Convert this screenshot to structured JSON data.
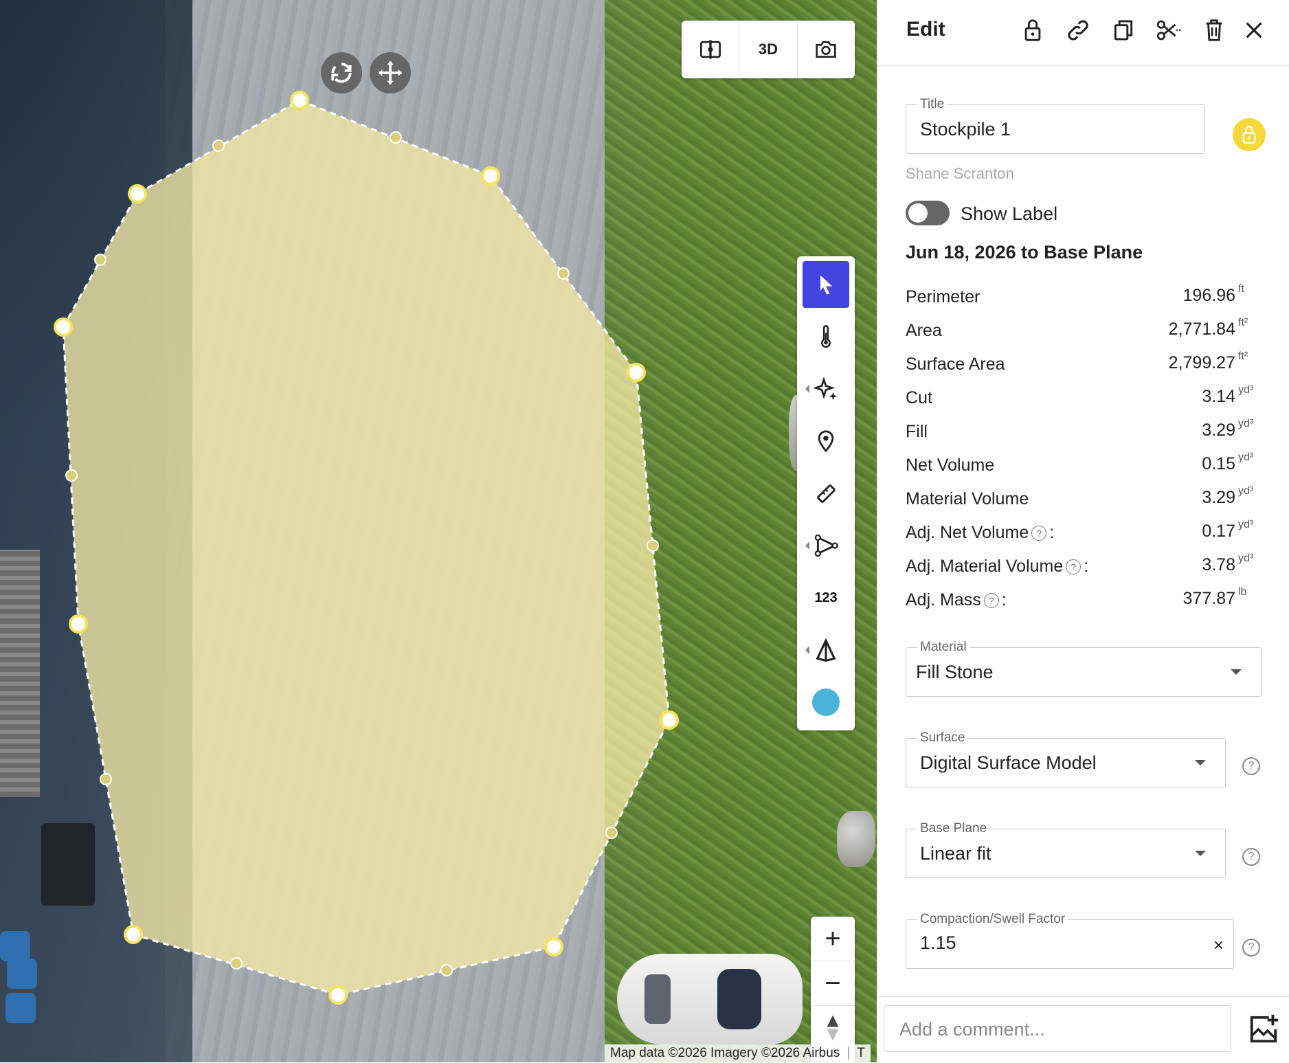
{
  "map": {
    "top_controls": {
      "split_label": "",
      "view3d_label": "3D",
      "camera_label": ""
    },
    "tools": [
      {
        "name": "select",
        "icon": "cursor-arrow-icon",
        "active": true
      },
      {
        "name": "thermal",
        "icon": "thermometer-icon"
      },
      {
        "name": "magic",
        "icon": "sparkle-icon"
      },
      {
        "name": "location",
        "icon": "map-pin-icon"
      },
      {
        "name": "measure",
        "icon": "ruler-icon"
      },
      {
        "name": "path",
        "icon": "path-nodes-icon"
      },
      {
        "name": "count",
        "label": "123"
      },
      {
        "name": "volume",
        "icon": "pyramid-icon"
      },
      {
        "name": "color",
        "icon": "color-dot-icon",
        "color": "#4bb3d8"
      }
    ],
    "zoom": {
      "in": "+",
      "out": "−"
    },
    "attribution": "Map data ©2026 Imagery ©2026 Airbus",
    "attribution_extra": "T",
    "polygon_fill": "#f0e6a0",
    "vertex_color": "#f8e45a"
  },
  "panel": {
    "title": "Edit",
    "header_icons": [
      "lock-open-icon",
      "link-icon",
      "copy-icon",
      "scissors-icon",
      "trash-icon",
      "close-icon"
    ],
    "title_field": {
      "label": "Title",
      "value": "Stockpile 1"
    },
    "author": "Shane Scranton",
    "show_label": {
      "label": "Show Label",
      "on": false
    },
    "comparison": "Jun 18, 2026 to Base Plane",
    "stats": [
      {
        "label": "Perimeter",
        "value": "196.96",
        "unit": "ft"
      },
      {
        "label": "Area",
        "value": "2,771.84",
        "unit": "ft²"
      },
      {
        "label": "Surface Area",
        "value": "2,799.27",
        "unit": "ft²"
      },
      {
        "label": "Cut",
        "value": "3.14",
        "unit": "yd³"
      },
      {
        "label": "Fill",
        "value": "3.29",
        "unit": "yd³"
      },
      {
        "label": "Net Volume",
        "value": "0.15",
        "unit": "yd³"
      },
      {
        "label": "Material Volume",
        "value": "3.29",
        "unit": "yd³"
      },
      {
        "label": "Adj. Net Volume",
        "value": "0.17",
        "unit": "yd³",
        "help": true
      },
      {
        "label": "Adj. Material Volume",
        "value": "3.78",
        "unit": "yd³",
        "help": true
      },
      {
        "label": "Adj. Mass",
        "value": "377.87",
        "unit": "lb",
        "help": true
      }
    ],
    "material": {
      "label": "Material",
      "value": "Fill Stone"
    },
    "surface": {
      "label": "Surface",
      "value": "Digital Surface Model"
    },
    "base_plane": {
      "label": "Base Plane",
      "value": "Linear fit"
    },
    "compaction": {
      "label": "Compaction/Swell Factor",
      "value": "1.15"
    },
    "comment_placeholder": "Add a comment...",
    "help_glyph": "?",
    "clear_glyph": "×",
    "colon": ":"
  }
}
